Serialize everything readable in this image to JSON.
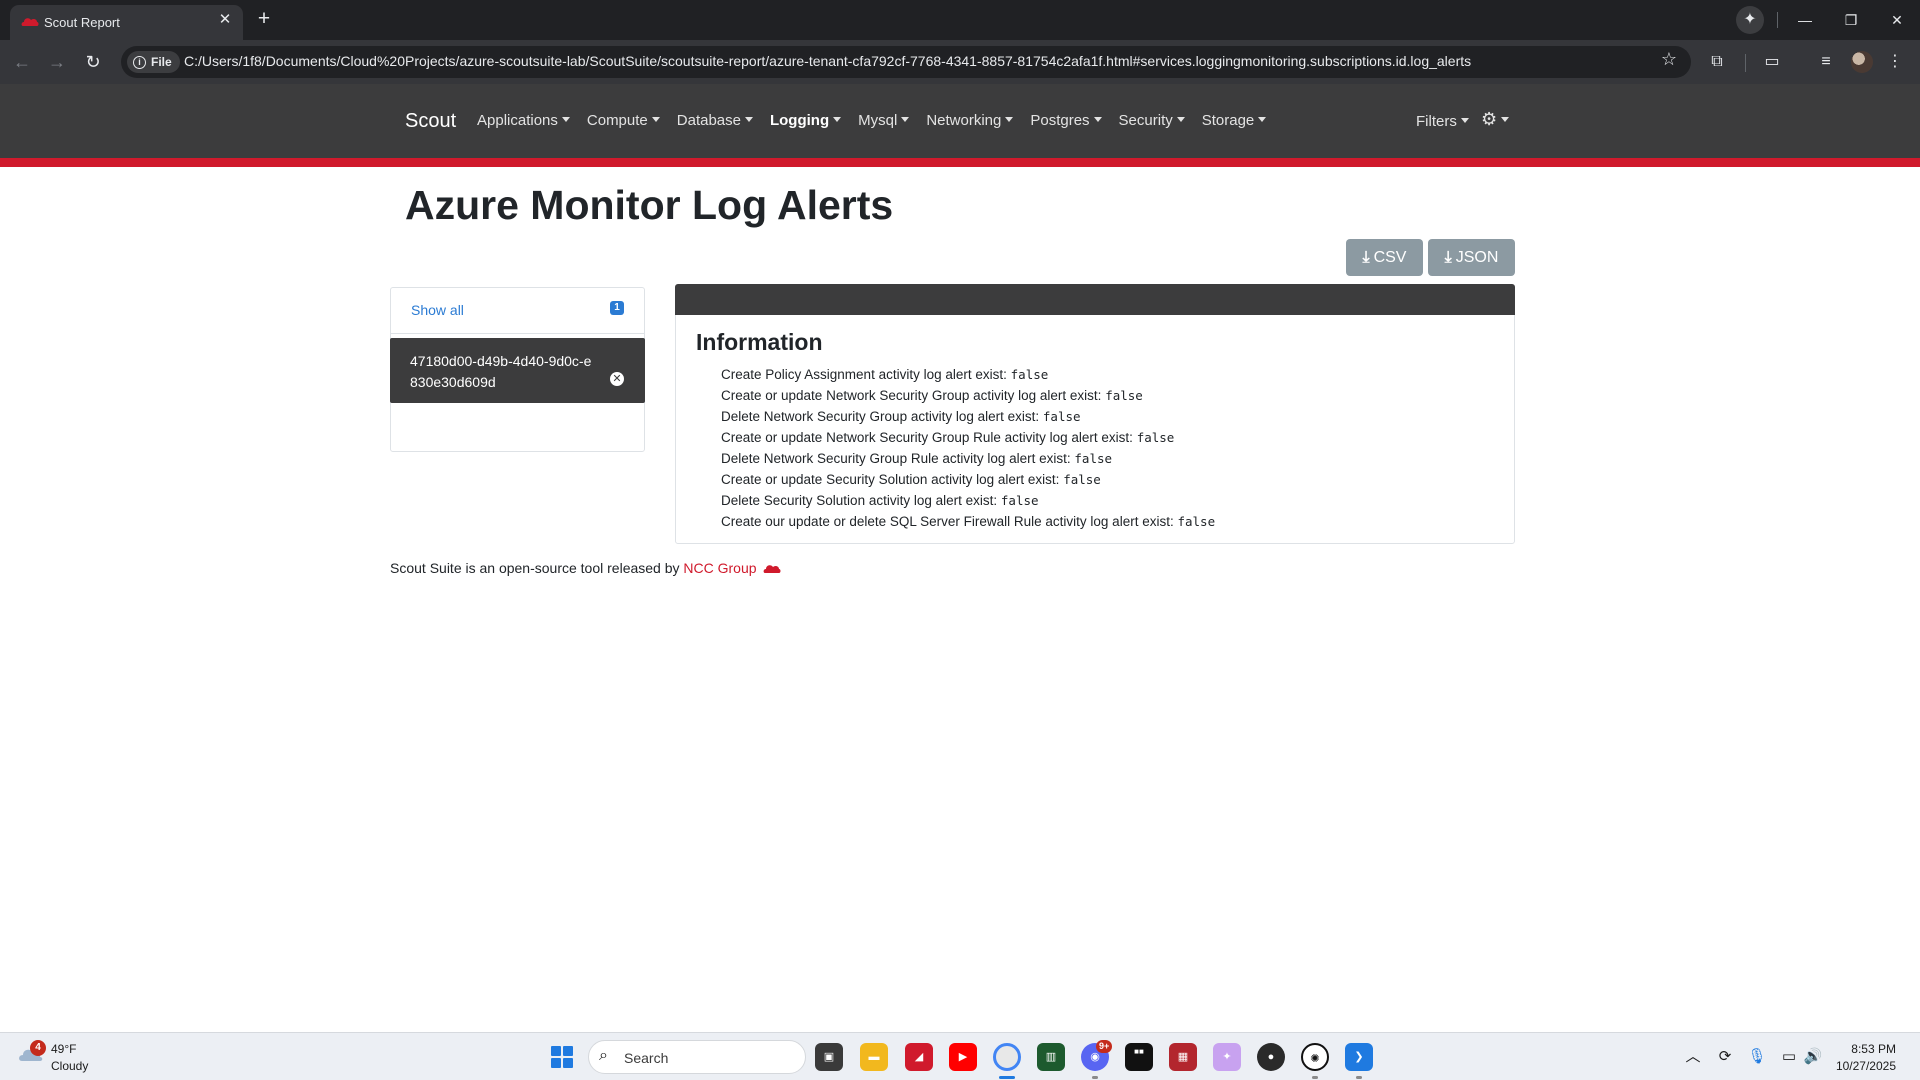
{
  "browser": {
    "tab_title": "Scout Report",
    "tab_close": "✕",
    "new_tab": "+",
    "chip_label": "File",
    "url": "C:/Users/1f8/Documents/Cloud%20Projects/azure-scoutsuite-lab/ScoutSuite/scoutsuite-report/azure-tenant-cfa792cf-7768-4341-8857-81754c2afa1f.html#services.loggingmonitoring.subscriptions.id.log_alerts",
    "icons": [
      "back-icon",
      "forward-icon",
      "reload-icon",
      "site-info-icon",
      "bookmark-star-icon",
      "extensions-icon",
      "media-icon",
      "reading-list-icon",
      "profile-avatar",
      "menu-icon"
    ]
  },
  "navbar": {
    "brand": "Scout",
    "menu": [
      {
        "label": "Applications",
        "active": false
      },
      {
        "label": "Compute",
        "active": false
      },
      {
        "label": "Database",
        "active": false
      },
      {
        "label": "Logging",
        "active": true
      },
      {
        "label": "Mysql",
        "active": false
      },
      {
        "label": "Networking",
        "active": false
      },
      {
        "label": "Postgres",
        "active": false
      },
      {
        "label": "Security",
        "active": false
      },
      {
        "label": "Storage",
        "active": false
      }
    ],
    "filters": "Filters",
    "accent_color": "#d01a2c"
  },
  "page": {
    "title": "Azure Monitor Log Alerts",
    "csv_label": "CSV",
    "json_label": "JSON"
  },
  "sidebar": {
    "show_all": "Show all",
    "count": "1",
    "items": [
      {
        "id": "47180d00-d49b-4d40-9d0c-e830e30d609d"
      }
    ]
  },
  "info": {
    "heading": "Information",
    "rows": [
      {
        "label": "Create Policy Assignment activity log alert exist:",
        "value": "false"
      },
      {
        "label": "Create or update Network Security Group activity log alert exist:",
        "value": "false"
      },
      {
        "label": "Delete Network Security Group activity log alert exist:",
        "value": "false"
      },
      {
        "label": "Create or update Network Security Group Rule activity log alert exist:",
        "value": "false"
      },
      {
        "label": "Delete Network Security Group Rule activity log alert exist:",
        "value": "false"
      },
      {
        "label": "Create or update Security Solution activity log alert exist:",
        "value": "false"
      },
      {
        "label": "Delete Security Solution activity log alert exist:",
        "value": "false"
      },
      {
        "label": "Create our update or delete SQL Server Firewall Rule activity log alert exist:",
        "value": "false"
      }
    ]
  },
  "footer": {
    "text": "Scout Suite is an open-source tool released by",
    "link": "NCC Group"
  },
  "taskbar": {
    "weather_badge": "4",
    "temperature": "49°F",
    "condition": "Cloudy",
    "search": "Search",
    "time": "8:53 PM",
    "date": "10/27/2025",
    "discord_badge": "9+"
  }
}
